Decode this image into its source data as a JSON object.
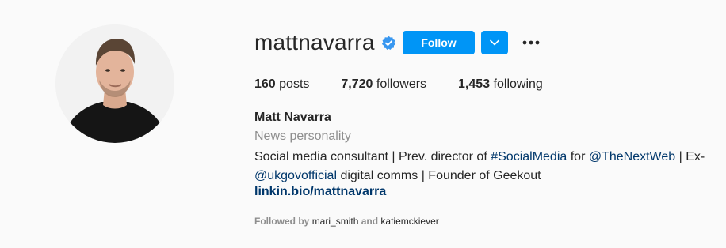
{
  "profile": {
    "username": "mattnavarra",
    "full_name": "Matt Navarra",
    "category": "News personality",
    "website": "linkin.bio/mattnavarra",
    "verified_icon": "verified-badge-icon"
  },
  "actions": {
    "follow_label": "Follow",
    "dropdown_icon": "chevron-down-icon",
    "more_icon": "more-options-icon"
  },
  "stats": {
    "posts_count": "160",
    "posts_label": "posts",
    "followers_count": "7,720",
    "followers_label": "followers",
    "following_count": "1,453",
    "following_label": "following"
  },
  "bio": {
    "text1": "Social media consultant | Prev. director of ",
    "hashtag": "#SocialMedia",
    "text2": " for ",
    "mention1": "@TheNextWeb",
    "text3": " | Ex-",
    "mention2": "@ukgovofficial",
    "text4": " digital comms | Founder of Geekout"
  },
  "followed_by": {
    "prefix": "Followed by",
    "user1": "mari_smith",
    "and": "and",
    "user2": "katiemckiever"
  },
  "colors": {
    "accent": "#0095f6",
    "link": "#00376b",
    "secondary_text": "#8e8e8e"
  }
}
